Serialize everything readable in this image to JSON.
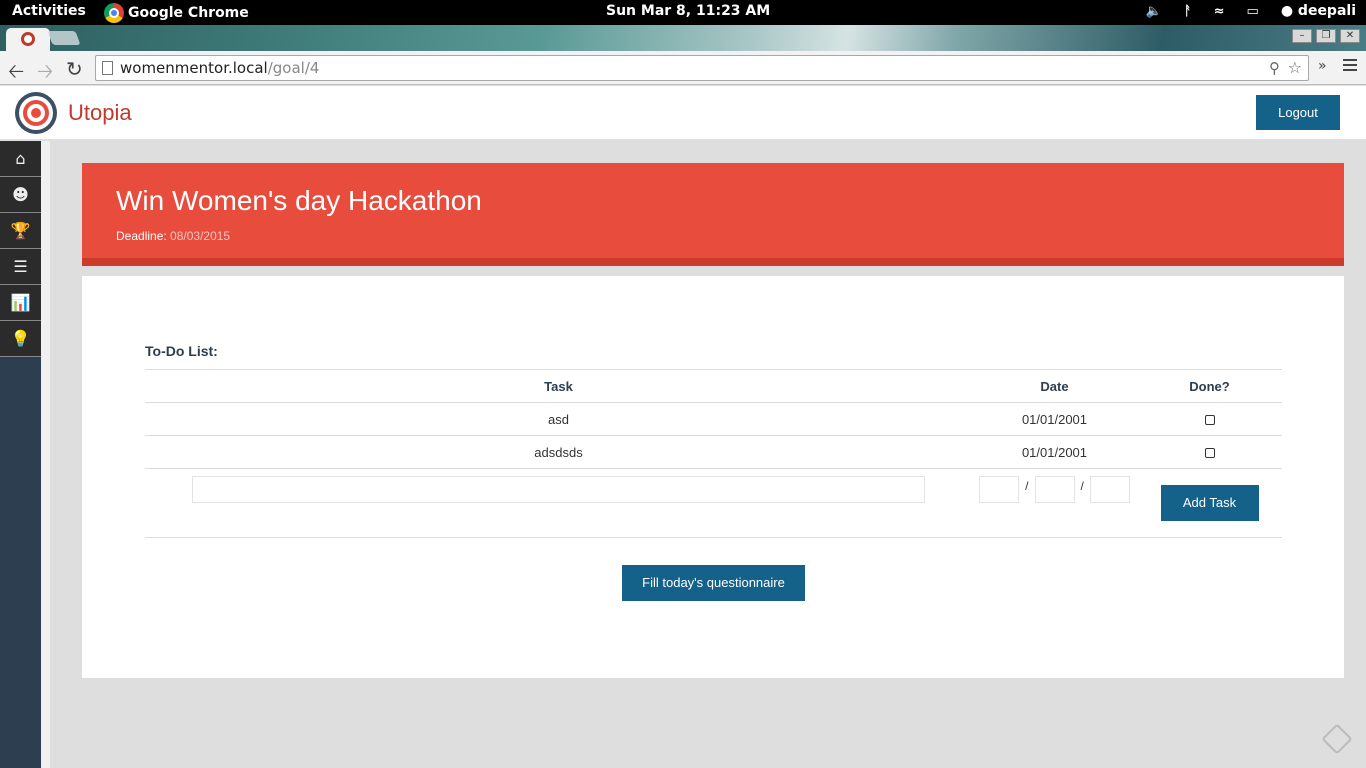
{
  "system": {
    "activities": "Activities",
    "app_name": "Google Chrome",
    "clock": "Sun Mar  8, 11:23 AM",
    "user": "deepali"
  },
  "browser": {
    "url_host": "womenmentor.local",
    "url_path": "/goal/4"
  },
  "app": {
    "brand": "Utopia",
    "logout_label": "Logout",
    "accent_red": "#e74c3c",
    "accent_blue": "#146189"
  },
  "sidebar": {
    "items": [
      {
        "icon": "home-icon"
      },
      {
        "icon": "user-icon"
      },
      {
        "icon": "trophy-icon"
      },
      {
        "icon": "list-icon"
      },
      {
        "icon": "chart-icon"
      },
      {
        "icon": "lightbulb-icon"
      }
    ]
  },
  "goal": {
    "title": "Win Women's day Hackathon",
    "deadline_label": "Deadline:",
    "deadline_value": "08/03/2015"
  },
  "todo": {
    "heading": "To-Do List:",
    "columns": {
      "task": "Task",
      "date": "Date",
      "done": "Done?"
    },
    "rows": [
      {
        "task": "asd",
        "date": "01/01/2001",
        "done": false
      },
      {
        "task": "adsdsds",
        "date": "01/01/2001",
        "done": false
      }
    ],
    "date_separator": "/",
    "add_task_label": "Add Task"
  },
  "questionnaire_button": "Fill today's questionnaire"
}
